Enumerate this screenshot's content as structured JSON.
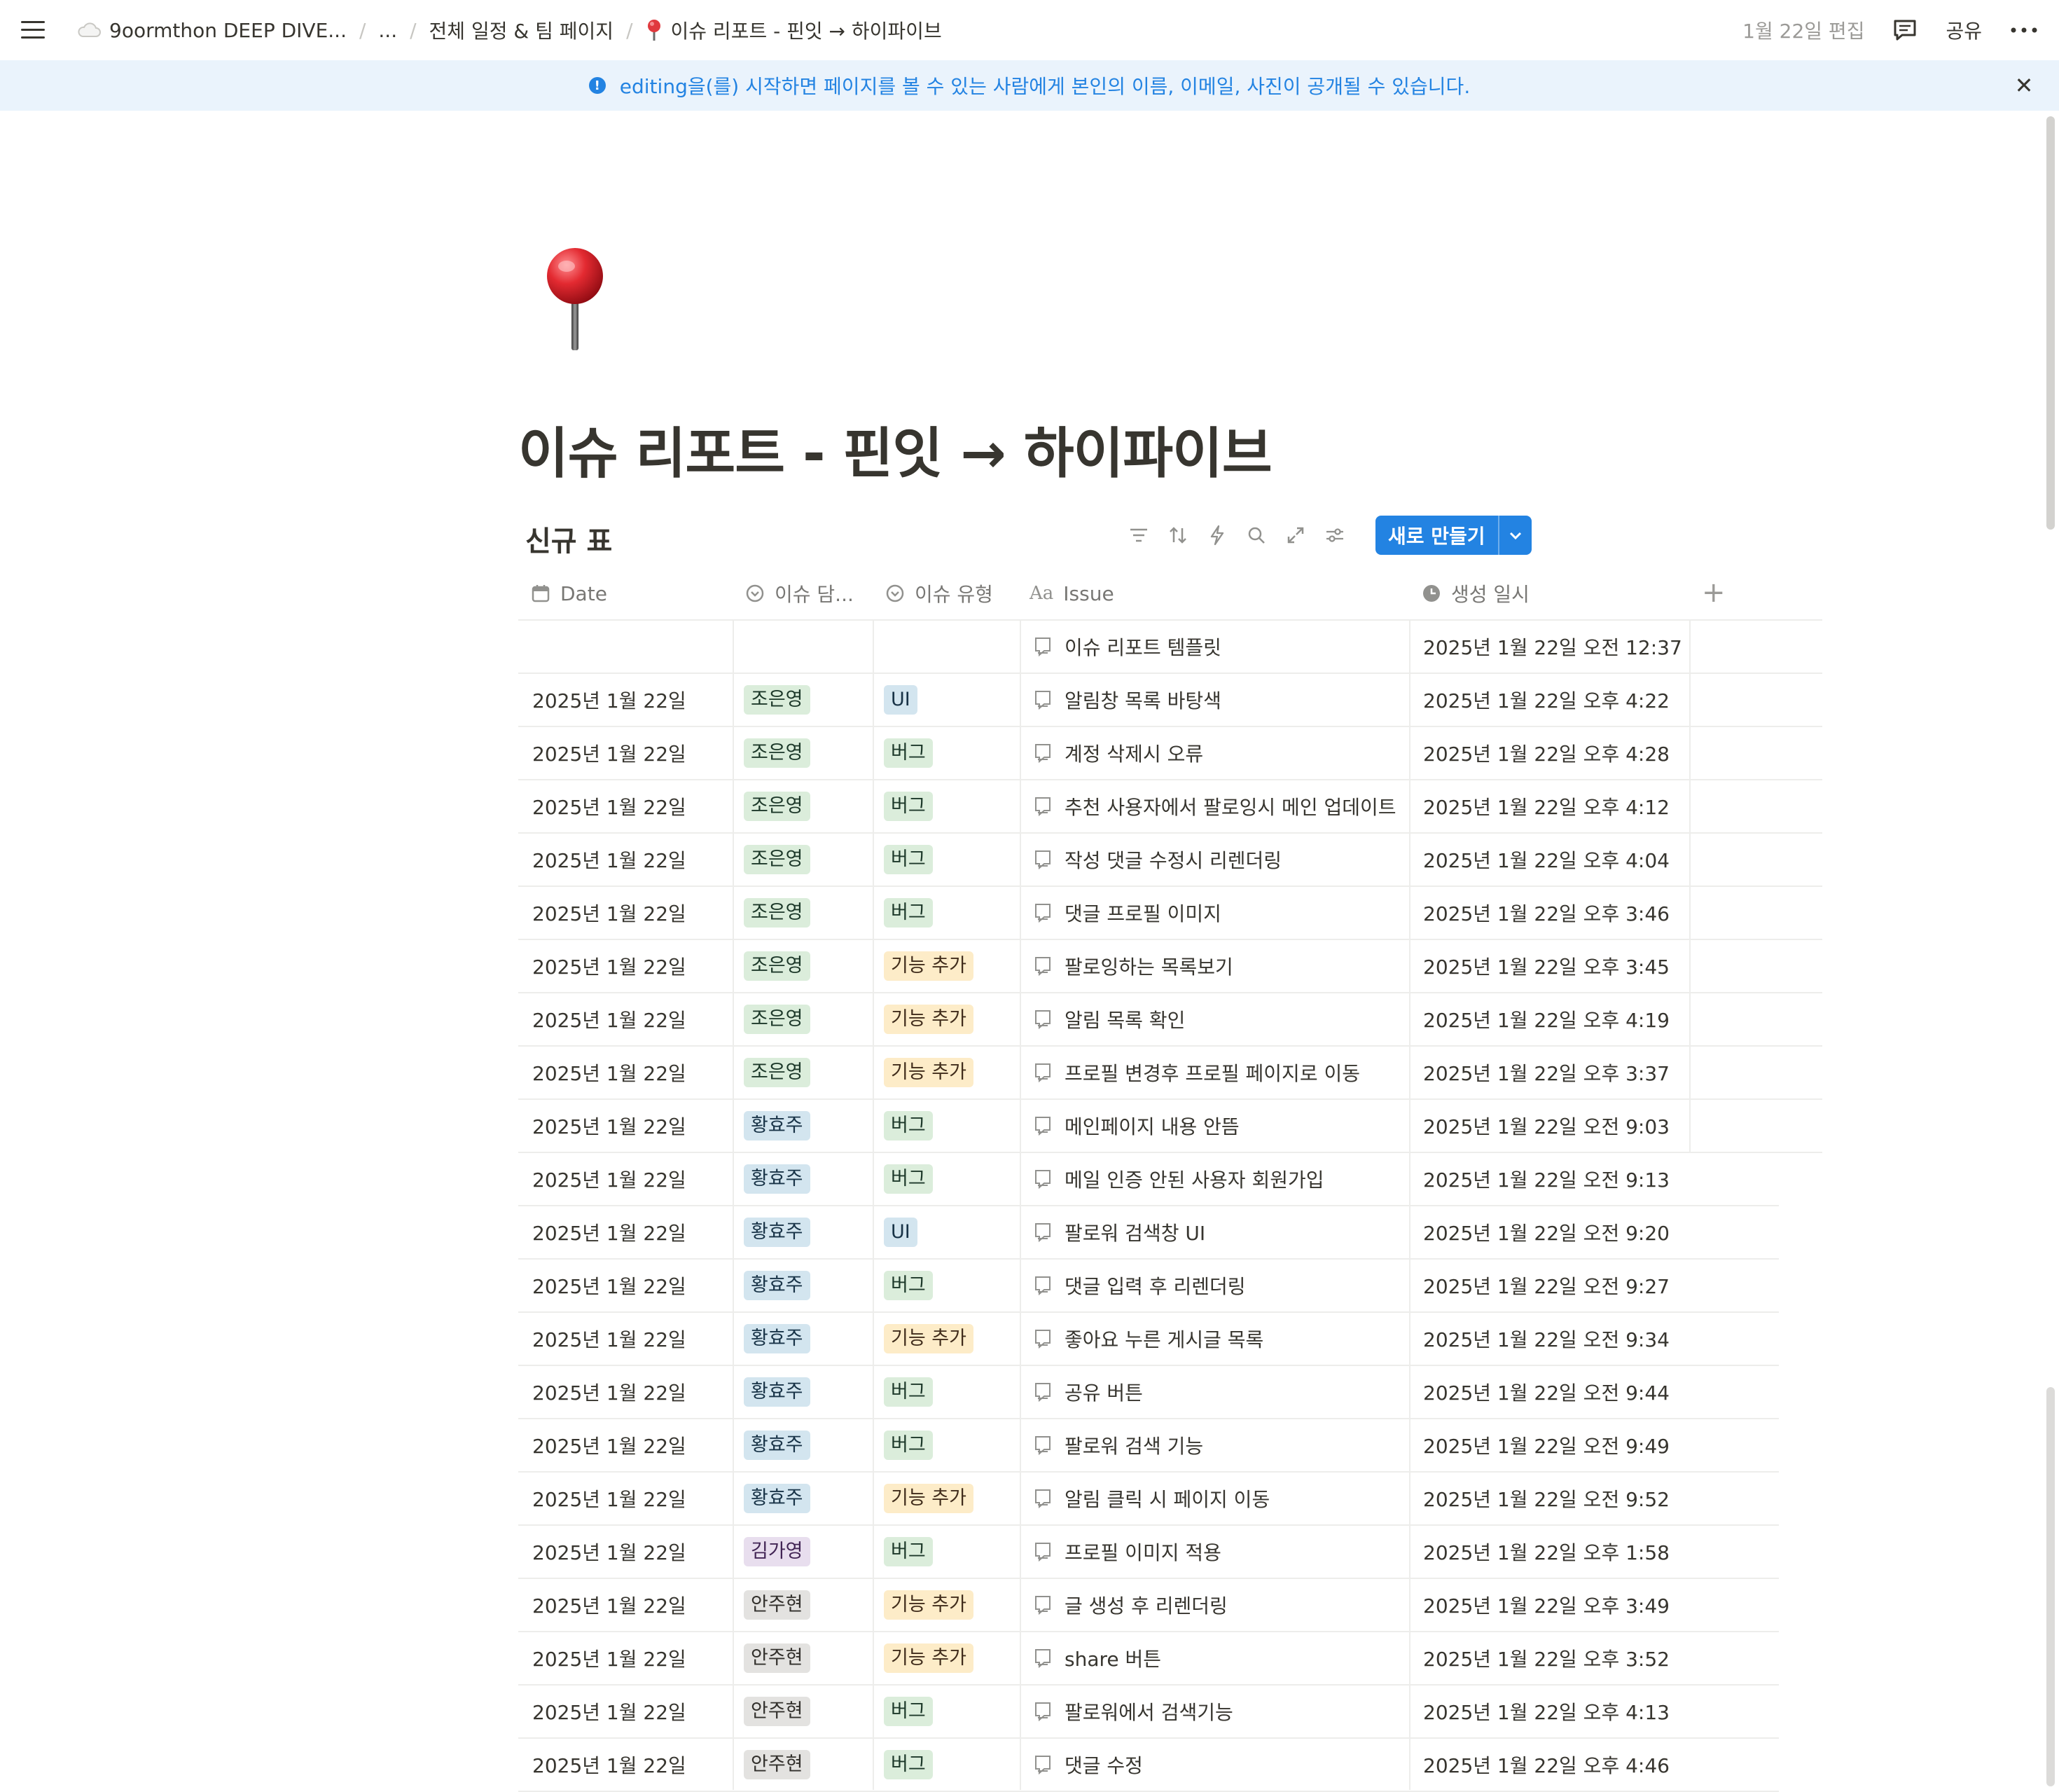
{
  "topbar": {
    "workspace": "9oormthon DEEP DIVE...",
    "ellipsis": "...",
    "parent_page": "전체 일정 & 팀 페이지",
    "current_page": "이슈 리포트 - 핀잇 → 하이파이브",
    "edited": "1월 22일 편집",
    "share": "공유",
    "more": "···"
  },
  "banner": {
    "message": "editing을(를) 시작하면 페이지를 볼 수 있는 사람에게 본인의 이름, 이메일, 사진이 공개될 수 있습니다.",
    "close": "✕"
  },
  "page": {
    "title": "이슈 리포트 - 핀잇 → 하이파이브"
  },
  "database": {
    "title": "신규 표",
    "new_button": "새로 만들기",
    "columns": {
      "date": "Date",
      "assignee": "이슈 담...",
      "type": "이슈 유형",
      "issue": "Issue",
      "created": "생성 일시"
    },
    "add_column": "+",
    "rows": [
      {
        "date": "",
        "assignee": "",
        "type": "",
        "issue": "이슈 리포트 템플릿",
        "created": "2025년 1월 22일 오전 12:37"
      },
      {
        "date": "2025년 1월 22일",
        "assignee": "조은영",
        "type": "UI",
        "issue": "알림창 목록 바탕색",
        "created": "2025년 1월 22일 오후 4:22"
      },
      {
        "date": "2025년 1월 22일",
        "assignee": "조은영",
        "type": "버그",
        "issue": "계정 삭제시 오류",
        "created": "2025년 1월 22일 오후 4:28"
      },
      {
        "date": "2025년 1월 22일",
        "assignee": "조은영",
        "type": "버그",
        "issue": "추천 사용자에서 팔로잉시 메인 업데이트",
        "created": "2025년 1월 22일 오후 4:12"
      },
      {
        "date": "2025년 1월 22일",
        "assignee": "조은영",
        "type": "버그",
        "issue": "작성 댓글 수정시 리렌더링",
        "created": "2025년 1월 22일 오후 4:04"
      },
      {
        "date": "2025년 1월 22일",
        "assignee": "조은영",
        "type": "버그",
        "issue": "댓글 프로필 이미지",
        "created": "2025년 1월 22일 오후 3:46"
      },
      {
        "date": "2025년 1월 22일",
        "assignee": "조은영",
        "type": "기능 추가",
        "issue": "팔로잉하는 목록보기",
        "created": "2025년 1월 22일 오후 3:45"
      },
      {
        "date": "2025년 1월 22일",
        "assignee": "조은영",
        "type": "기능 추가",
        "issue": "알림 목록 확인",
        "created": "2025년 1월 22일 오후 4:19"
      },
      {
        "date": "2025년 1월 22일",
        "assignee": "조은영",
        "type": "기능 추가",
        "issue": "프로필 변경후 프로필 페이지로 이동",
        "created": "2025년 1월 22일 오후 3:37"
      },
      {
        "date": "2025년 1월 22일",
        "assignee": "황효주",
        "type": "버그",
        "issue": "메인페이지 내용 안뜸",
        "created": "2025년 1월 22일 오전 9:03"
      },
      {
        "date": "2025년 1월 22일",
        "assignee": "황효주",
        "type": "버그",
        "issue": "메일 인증 안된 사용자 회원가입",
        "created": "2025년 1월 22일 오전 9:13"
      },
      {
        "date": "2025년 1월 22일",
        "assignee": "황효주",
        "type": "UI",
        "issue": "팔로워 검색창 UI",
        "created": "2025년 1월 22일 오전 9:20"
      },
      {
        "date": "2025년 1월 22일",
        "assignee": "황효주",
        "type": "버그",
        "issue": "댓글 입력 후 리렌더링",
        "created": "2025년 1월 22일 오전 9:27"
      },
      {
        "date": "2025년 1월 22일",
        "assignee": "황효주",
        "type": "기능 추가",
        "issue": "좋아요 누른 게시글 목록",
        "created": "2025년 1월 22일 오전 9:34"
      },
      {
        "date": "2025년 1월 22일",
        "assignee": "황효주",
        "type": "버그",
        "issue": "공유 버튼",
        "created": "2025년 1월 22일 오전 9:44"
      },
      {
        "date": "2025년 1월 22일",
        "assignee": "황효주",
        "type": "버그",
        "issue": "팔로워 검색 기능",
        "created": "2025년 1월 22일 오전 9:49"
      },
      {
        "date": "2025년 1월 22일",
        "assignee": "황효주",
        "type": "기능 추가",
        "issue": "알림 클릭 시 페이지 이동",
        "created": "2025년 1월 22일 오전 9:52"
      },
      {
        "date": "2025년 1월 22일",
        "assignee": "김가영",
        "type": "버그",
        "issue": "프로필 이미지 적용",
        "created": "2025년 1월 22일 오후 1:58"
      },
      {
        "date": "2025년 1월 22일",
        "assignee": "안주현",
        "type": "기능 추가",
        "issue": "글 생성 후 리렌더링",
        "created": "2025년 1월 22일 오후 3:49"
      },
      {
        "date": "2025년 1월 22일",
        "assignee": "안주현",
        "type": "기능 추가",
        "issue": "share 버튼",
        "created": "2025년 1월 22일 오후 3:52"
      },
      {
        "date": "2025년 1월 22일",
        "assignee": "안주현",
        "type": "버그",
        "issue": "팔로워에서 검색기능",
        "created": "2025년 1월 22일 오후 4:13"
      },
      {
        "date": "2025년 1월 22일",
        "assignee": "안주현",
        "type": "버그",
        "issue": "댓글 수정",
        "created": "2025년 1월 22일 오후 4:46"
      }
    ]
  },
  "tag_colors": {
    "조은영": "green",
    "황효주": "blue",
    "김가영": "purple",
    "안주현": "gray",
    "UI": "blue",
    "버그": "green",
    "기능 추가": "yellow"
  }
}
